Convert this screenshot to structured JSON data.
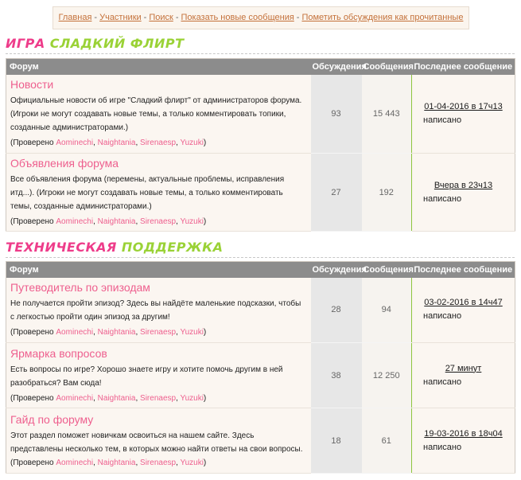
{
  "nav": {
    "links": [
      "Главная",
      "Участники",
      "Поиск",
      "Показать новые сообщения",
      "Пометить обсуждения как прочитанные"
    ],
    "separator": "-"
  },
  "colors": {
    "accent_pink": "#ee5f8e",
    "accent_green": "#9ad236",
    "header_gray": "#8c8c8c",
    "link_brown": "#c4713a"
  },
  "table_header": {
    "forum": "Форум",
    "topics": "Обсуждения",
    "posts": "Сообщения",
    "last": "Последнее сообщение"
  },
  "categories": [
    {
      "word1": "ИГРА",
      "word2": "СЛАДКИЙ ФЛИРТ",
      "forums": [
        {
          "title": "Новости",
          "description": "Официальные новости об игре \"Сладкий флирт\" от администраторов форума. (Игроки не могут создавать новые темы, а только комментировать топики, созданные администраторами.)",
          "mods_prefix": "(Проверено",
          "mods": [
            "Aominechi",
            "Naightania",
            "Sirenaesp",
            "Yuzuki"
          ],
          "mods_suffix": ")",
          "topics": "93",
          "posts": "15 443",
          "last_date": "01-04-2016 в 17ч13",
          "last_by": "написано"
        },
        {
          "title": "Объявления форума",
          "description": "Все объявления форума (перемены, актуальные проблемы, исправления итд...). (Игроки не могут создавать новые темы, а только комментировать темы, созданные администраторами.)",
          "mods_prefix": "(Проверено",
          "mods": [
            "Aominechi",
            "Naightania",
            "Sirenaesp",
            "Yuzuki"
          ],
          "mods_suffix": ")",
          "topics": "27",
          "posts": "192",
          "last_date": "Вчера в 23ч13",
          "last_by": "написано"
        }
      ]
    },
    {
      "word1": "ТЕХНИЧЕСКАЯ",
      "word2": "ПОДДЕРЖКА",
      "forums": [
        {
          "title": "Путеводитель по эпизодам",
          "description": "Не получается пройти эпизод? Здесь вы найдёте маленькие подсказки, чтобы с легкостью пройти один эпизод за другим!",
          "mods_prefix": "(Проверено",
          "mods": [
            "Aominechi",
            "Naightania",
            "Sirenaesp",
            "Yuzuki"
          ],
          "mods_suffix": ")",
          "topics": "28",
          "posts": "94",
          "last_date": "03-02-2016 в 14ч47",
          "last_by": "написано"
        },
        {
          "title": "Ярмарка вопросов",
          "description": "Есть вопросы по игре? Хорошо знаете игру и хотите помочь другим в ней разобраться? Вам сюда!",
          "mods_prefix": "(Проверено",
          "mods": [
            "Aominechi",
            "Naightania",
            "Sirenaesp",
            "Yuzuki"
          ],
          "mods_suffix": ")",
          "topics": "38",
          "posts": "12 250",
          "last_date": "27 минут",
          "last_by": "написано"
        },
        {
          "title": "Гайд по форуму",
          "description": "Этот раздел поможет новичкам освоиться на нашем сайте. Здесь представлены несколько тем, в которых можно найти ответы на свои вопросы.",
          "mods_prefix": "(Проверено",
          "mods": [
            "Aominechi",
            "Naightania",
            "Sirenaesp",
            "Yuzuki"
          ],
          "mods_suffix": ")",
          "topics": "18",
          "posts": "61",
          "last_date": "19-03-2016 в 18ч04",
          "last_by": "написано"
        }
      ]
    }
  ]
}
